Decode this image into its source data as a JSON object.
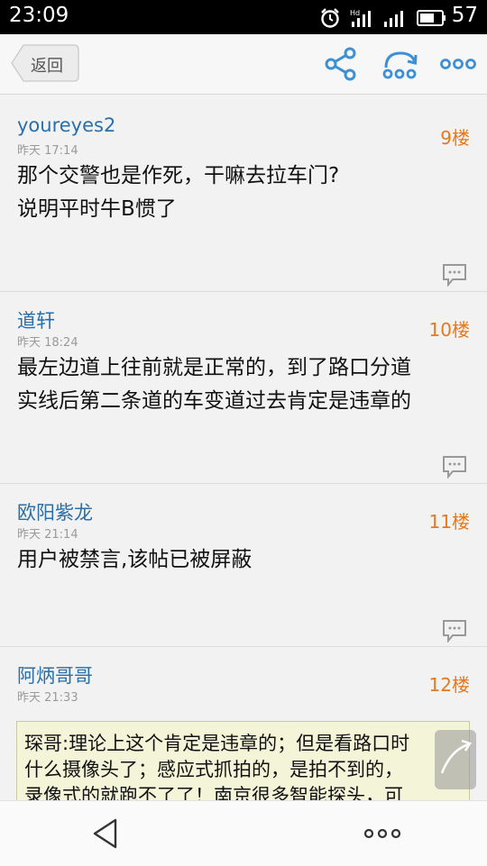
{
  "status": {
    "time": "23:09",
    "battery": "57"
  },
  "header": {
    "back_label": "返回"
  },
  "posts": [
    {
      "author": "youreyes2",
      "time": "昨天 17:14",
      "floor": "9楼",
      "lines": [
        "那个交警也是作死，干嘛去拉车门?",
        "说明平时牛B惯了"
      ]
    },
    {
      "author": "道轩",
      "time": "昨天 18:24",
      "floor": "10楼",
      "lines": [
        "最左边道上往前就是正常的，到了路口分道",
        "实线后第二条道的车变道过去肯定是违章的"
      ]
    },
    {
      "author": "欧阳紫龙",
      "time": "昨天 21:14",
      "floor": "11楼",
      "lines": [
        "用户被禁言,该帖已被屏蔽"
      ]
    },
    {
      "author": "阿炳哥哥",
      "time": "昨天 21:33",
      "floor": "12楼",
      "quote_lines": [
        "琛哥:理论上这个肯定是违章的；但是看路口时",
        "什么摄像头了；感应式抓拍的，是拍不到的，",
        "录像式的就跑不了了！南京很多智能探头，可"
      ]
    }
  ]
}
